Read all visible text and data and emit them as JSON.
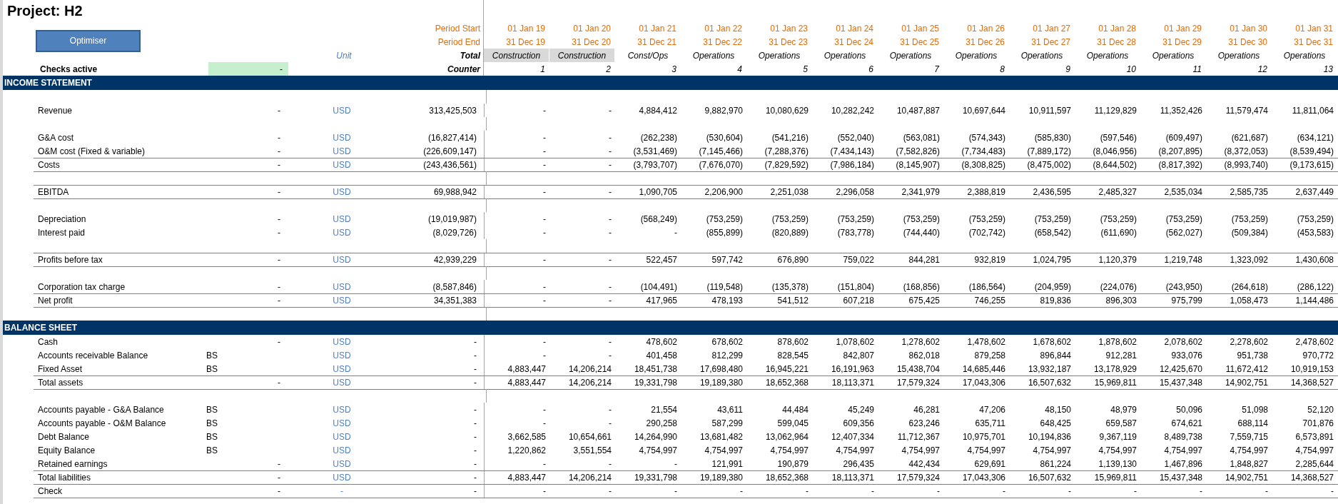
{
  "title": "Project: H2",
  "optimiser_button": "Optimiser",
  "header": {
    "period_start_label": "Period Start",
    "period_end_label": "Period End",
    "unit_label": "Unit",
    "total_label": "Total",
    "checks_label": "Checks active",
    "checks_value": "-",
    "counter_label": "Counter"
  },
  "periods": [
    {
      "start": "01 Jan 19",
      "end": "31 Dec 19",
      "phase": "Construction",
      "highlighted": true,
      "counter": "1"
    },
    {
      "start": "01 Jan 20",
      "end": "31 Dec 20",
      "phase": "Construction",
      "highlighted": true,
      "counter": "2"
    },
    {
      "start": "01 Jan 21",
      "end": "31 Dec 21",
      "phase": "Const/Ops",
      "highlighted": false,
      "counter": "3"
    },
    {
      "start": "01 Jan 22",
      "end": "31 Dec 22",
      "phase": "Operations",
      "highlighted": false,
      "counter": "4"
    },
    {
      "start": "01 Jan 23",
      "end": "31 Dec 23",
      "phase": "Operations",
      "highlighted": false,
      "counter": "5"
    },
    {
      "start": "01 Jan 24",
      "end": "31 Dec 24",
      "phase": "Operations",
      "highlighted": false,
      "counter": "6"
    },
    {
      "start": "01 Jan 25",
      "end": "31 Dec 25",
      "phase": "Operations",
      "highlighted": false,
      "counter": "7"
    },
    {
      "start": "01 Jan 26",
      "end": "31 Dec 26",
      "phase": "Operations",
      "highlighted": false,
      "counter": "8"
    },
    {
      "start": "01 Jan 27",
      "end": "31 Dec 27",
      "phase": "Operations",
      "highlighted": false,
      "counter": "9"
    },
    {
      "start": "01 Jan 28",
      "end": "31 Dec 28",
      "phase": "Operations",
      "highlighted": false,
      "counter": "10"
    },
    {
      "start": "01 Jan 29",
      "end": "31 Dec 29",
      "phase": "Operations",
      "highlighted": false,
      "counter": "11"
    },
    {
      "start": "01 Jan 30",
      "end": "31 Dec 30",
      "phase": "Operations",
      "highlighted": false,
      "counter": "12"
    },
    {
      "start": "01 Jan 31",
      "end": "31 Dec 31",
      "phase": "Operations",
      "highlighted": false,
      "counter": "13"
    }
  ],
  "sections": [
    {
      "title": "INCOME STATEMENT",
      "rows": [
        {
          "kind": "blank"
        },
        {
          "kind": "line",
          "label": "Revenue",
          "flag": "-",
          "unit": "USD",
          "total": "313,425,503",
          "values": [
            "-",
            "-",
            "4,884,412",
            "9,882,970",
            "10,080,629",
            "10,282,242",
            "10,487,887",
            "10,697,644",
            "10,911,597",
            "11,129,829",
            "11,352,426",
            "11,579,474",
            "11,811,064"
          ]
        },
        {
          "kind": "blank"
        },
        {
          "kind": "line",
          "label": "G&A cost",
          "flag": "-",
          "unit": "USD",
          "total": "(16,827,414)",
          "values": [
            "-",
            "-",
            "(262,238)",
            "(530,604)",
            "(541,216)",
            "(552,040)",
            "(563,081)",
            "(574,343)",
            "(585,830)",
            "(597,546)",
            "(609,497)",
            "(621,687)",
            "(634,121)"
          ]
        },
        {
          "kind": "line",
          "label": "O&M cost (Fixed & variable)",
          "flag": "-",
          "unit": "USD",
          "total": "(226,609,147)",
          "values": [
            "-",
            "-",
            "(3,531,469)",
            "(7,145,466)",
            "(7,288,376)",
            "(7,434,143)",
            "(7,582,826)",
            "(7,734,483)",
            "(7,889,172)",
            "(8,046,956)",
            "(8,207,895)",
            "(8,372,053)",
            "(8,539,494)"
          ]
        },
        {
          "kind": "total",
          "label": "Costs",
          "flag": "-",
          "unit": "USD",
          "total": "(243,436,561)",
          "values": [
            "-",
            "-",
            "(3,793,707)",
            "(7,676,070)",
            "(7,829,592)",
            "(7,986,184)",
            "(8,145,907)",
            "(8,308,825)",
            "(8,475,002)",
            "(8,644,502)",
            "(8,817,392)",
            "(8,993,740)",
            "(9,173,615)"
          ]
        },
        {
          "kind": "blank"
        },
        {
          "kind": "total",
          "label": "EBITDA",
          "flag": "-",
          "unit": "USD",
          "total": "69,988,942",
          "values": [
            "-",
            "-",
            "1,090,705",
            "2,206,900",
            "2,251,038",
            "2,296,058",
            "2,341,979",
            "2,388,819",
            "2,436,595",
            "2,485,327",
            "2,535,034",
            "2,585,735",
            "2,637,449"
          ]
        },
        {
          "kind": "blank"
        },
        {
          "kind": "line",
          "label": "Depreciation",
          "flag": "-",
          "unit": "USD",
          "total": "(19,019,987)",
          "values": [
            "-",
            "-",
            "(568,249)",
            "(753,259)",
            "(753,259)",
            "(753,259)",
            "(753,259)",
            "(753,259)",
            "(753,259)",
            "(753,259)",
            "(753,259)",
            "(753,259)",
            "(753,259)"
          ]
        },
        {
          "kind": "line",
          "label": "Interest paid",
          "flag": "-",
          "unit": "USD",
          "total": "(8,029,726)",
          "values": [
            "-",
            "-",
            "-",
            "(855,899)",
            "(820,889)",
            "(783,778)",
            "(744,440)",
            "(702,742)",
            "(658,542)",
            "(611,690)",
            "(562,027)",
            "(509,384)",
            "(453,583)"
          ]
        },
        {
          "kind": "blank"
        },
        {
          "kind": "total",
          "label": "Profits before tax",
          "flag": "-",
          "unit": "USD",
          "total": "42,939,229",
          "values": [
            "-",
            "-",
            "522,457",
            "597,742",
            "676,890",
            "759,022",
            "844,281",
            "932,819",
            "1,024,795",
            "1,120,379",
            "1,219,748",
            "1,323,092",
            "1,430,608"
          ]
        },
        {
          "kind": "blank"
        },
        {
          "kind": "line",
          "label": "Corporation tax charge",
          "flag": "-",
          "unit": "USD",
          "total": "(8,587,846)",
          "values": [
            "-",
            "-",
            "(104,491)",
            "(119,548)",
            "(135,378)",
            "(151,804)",
            "(168,856)",
            "(186,564)",
            "(204,959)",
            "(224,076)",
            "(243,950)",
            "(264,618)",
            "(286,122)"
          ]
        },
        {
          "kind": "total",
          "label": "Net profit",
          "flag": "-",
          "unit": "USD",
          "total": "34,351,383",
          "values": [
            "-",
            "-",
            "417,965",
            "478,193",
            "541,512",
            "607,218",
            "675,425",
            "746,255",
            "819,836",
            "896,303",
            "975,799",
            "1,058,473",
            "1,144,486"
          ]
        },
        {
          "kind": "blank"
        }
      ]
    },
    {
      "title": "BALANCE SHEET",
      "rows": [
        {
          "kind": "line",
          "label": "Cash",
          "flag": "-",
          "unit": "USD",
          "total": "-",
          "values": [
            "-",
            "-",
            "478,602",
            "678,602",
            "878,602",
            "1,078,602",
            "1,278,602",
            "1,478,602",
            "1,678,602",
            "1,878,602",
            "2,078,602",
            "2,278,602",
            "2,478,602"
          ]
        },
        {
          "kind": "line",
          "label": "Accounts receivable Balance",
          "tag": "BS",
          "unit": "USD",
          "total": "-",
          "values": [
            "-",
            "-",
            "401,458",
            "812,299",
            "828,545",
            "842,807",
            "862,018",
            "879,258",
            "896,844",
            "912,281",
            "933,076",
            "951,738",
            "970,772"
          ]
        },
        {
          "kind": "line",
          "label": "Fixed Asset",
          "tag": "BS",
          "unit": "USD",
          "total": "-",
          "values": [
            "4,883,447",
            "14,206,214",
            "18,451,738",
            "17,698,480",
            "16,945,221",
            "16,191,963",
            "15,438,704",
            "14,685,446",
            "13,932,187",
            "13,178,929",
            "12,425,670",
            "11,672,412",
            "10,919,153"
          ]
        },
        {
          "kind": "total",
          "label": "Total assets",
          "flag": "-",
          "unit": "USD",
          "total": "-",
          "values": [
            "4,883,447",
            "14,206,214",
            "19,331,798",
            "19,189,380",
            "18,652,368",
            "18,113,371",
            "17,579,324",
            "17,043,306",
            "16,507,632",
            "15,969,811",
            "15,437,348",
            "14,902,751",
            "14,368,527"
          ]
        },
        {
          "kind": "blank"
        },
        {
          "kind": "line",
          "label": "Accounts payable - G&A Balance",
          "tag": "BS",
          "unit": "USD",
          "total": "-",
          "values": [
            "-",
            "-",
            "21,554",
            "43,611",
            "44,484",
            "45,249",
            "46,281",
            "47,206",
            "48,150",
            "48,979",
            "50,096",
            "51,098",
            "52,120"
          ]
        },
        {
          "kind": "line",
          "label": "Accounts payable - O&M Balance",
          "tag": "BS",
          "unit": "USD",
          "total": "-",
          "values": [
            "-",
            "-",
            "290,258",
            "587,299",
            "599,045",
            "609,356",
            "623,246",
            "635,711",
            "648,425",
            "659,587",
            "674,621",
            "688,114",
            "701,876"
          ]
        },
        {
          "kind": "line",
          "label": "Debt Balance",
          "tag": "BS",
          "unit": "USD",
          "total": "-",
          "values": [
            "3,662,585",
            "10,654,661",
            "14,264,990",
            "13,681,482",
            "13,062,964",
            "12,407,334",
            "11,712,367",
            "10,975,701",
            "10,194,836",
            "9,367,119",
            "8,489,738",
            "7,559,715",
            "6,573,891"
          ]
        },
        {
          "kind": "line",
          "label": "Equity Balance",
          "tag": "BS",
          "unit": "USD",
          "total": "-",
          "values": [
            "1,220,862",
            "3,551,554",
            "4,754,997",
            "4,754,997",
            "4,754,997",
            "4,754,997",
            "4,754,997",
            "4,754,997",
            "4,754,997",
            "4,754,997",
            "4,754,997",
            "4,754,997",
            "4,754,997"
          ]
        },
        {
          "kind": "line",
          "label": "Retained earnings",
          "flag": "-",
          "unit": "USD",
          "total": "-",
          "values": [
            "-",
            "-",
            "-",
            "121,991",
            "190,879",
            "296,435",
            "442,434",
            "629,691",
            "861,224",
            "1,139,130",
            "1,467,896",
            "1,848,827",
            "2,285,644"
          ]
        },
        {
          "kind": "total",
          "label": "Total liabilities",
          "flag": "-",
          "unit": "USD",
          "total": "-",
          "values": [
            "4,883,447",
            "14,206,214",
            "19,331,798",
            "19,189,380",
            "18,652,368",
            "18,113,371",
            "17,579,324",
            "17,043,306",
            "16,507,632",
            "15,969,811",
            "15,437,348",
            "14,902,751",
            "14,368,527"
          ]
        },
        {
          "kind": "total",
          "label": "Check",
          "flag": "-",
          "unit": "-",
          "total": "-",
          "values": [
            "-",
            "-",
            "-",
            "-",
            "-",
            "-",
            "-",
            "-",
            "-",
            "-",
            "-",
            "-",
            "-"
          ]
        }
      ]
    }
  ]
}
